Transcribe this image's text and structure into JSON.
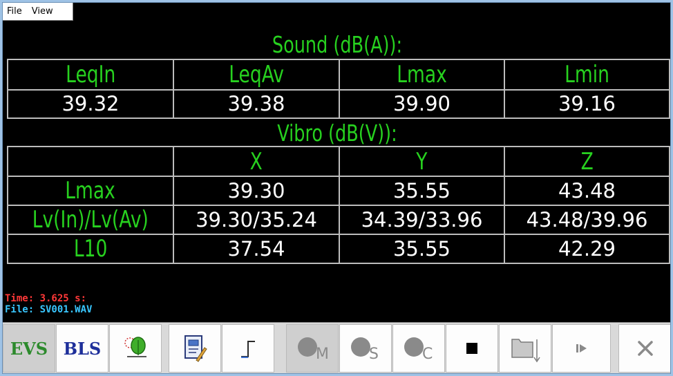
{
  "menu": {
    "file": "File",
    "view": "View"
  },
  "sound": {
    "title": "Sound (dB(A)):",
    "headers": [
      "LeqIn",
      "LeqAv",
      "Lmax",
      "Lmin"
    ],
    "values": [
      "39.32",
      "39.38",
      "39.90",
      "39.16"
    ]
  },
  "vibro": {
    "title": "Vibro (dB(V)):",
    "axes": [
      "",
      "X",
      "Y",
      "Z"
    ],
    "rows": [
      {
        "label": "Lmax",
        "values": [
          "39.30",
          "35.55",
          "43.48"
        ]
      },
      {
        "label": "Lv(In)/Lv(Av)",
        "values": [
          "39.30/35.24",
          "34.39/33.96",
          "43.48/39.96"
        ]
      },
      {
        "label": "L10",
        "values": [
          "37.54",
          "35.55",
          "42.29"
        ]
      }
    ]
  },
  "status": {
    "time": "Time: 3.625 s:",
    "file": "File:  SV001.WAV"
  },
  "toolbar": {
    "evs": "EVS",
    "bls": "BLS",
    "rec_m_sub": "M",
    "rec_s_sub": "S",
    "rec_c_sub": "C",
    "icons": [
      "tree-icon",
      "report-icon",
      "step-icon",
      "record-m-icon",
      "record-s-icon",
      "record-c-icon",
      "stop-icon",
      "folder-icon",
      "play-icon",
      "close-icon"
    ]
  },
  "colors": {
    "label_green": "#27d11f",
    "time_red": "#ff3838",
    "file_cyan": "#39c6ff",
    "background": "#000000"
  }
}
